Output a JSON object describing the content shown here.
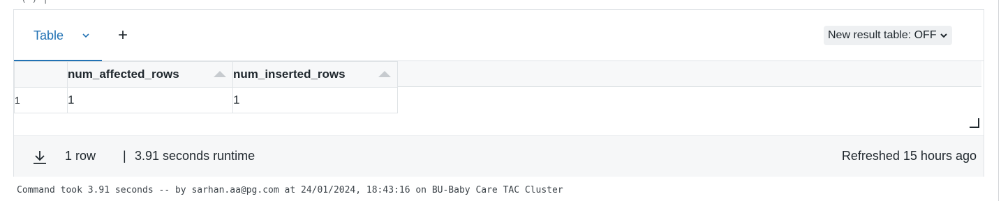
{
  "top_fragment": "(  )  |",
  "tabs": {
    "active_label": "Table",
    "add_symbol": "+"
  },
  "toggle": {
    "label": "New result table: OFF"
  },
  "table": {
    "columns": [
      "num_affected_rows",
      "num_inserted_rows"
    ],
    "rows": [
      {
        "index": "1",
        "cells": [
          "1",
          "1"
        ]
      }
    ]
  },
  "footer": {
    "rows_label": "1 row",
    "separator": "|",
    "runtime_label": "3.91 seconds runtime",
    "refreshed_label": "Refreshed 15 hours ago"
  },
  "command_line": "Command took 3.91 seconds -- by sarhan.aa@pg.com at 24/01/2024, 18:43:16 on BU-Baby Care TAC Cluster",
  "colors": {
    "accent": "#2272b4",
    "border": "#dfe3e6",
    "header_bg": "#f7f8f9",
    "footer_bg": "#f6f7f8"
  },
  "icons": {
    "tab_menu": "chevron-down-icon",
    "toggle_menu": "chevron-down-icon",
    "download": "download-icon",
    "resize": "resize-handle-icon",
    "sort": "sort-asc-icon"
  }
}
